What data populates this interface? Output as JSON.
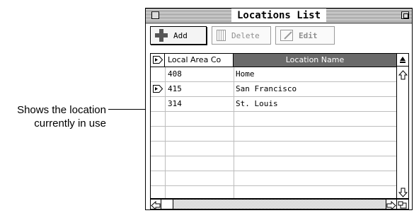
{
  "callout": {
    "line1": "Shows the location",
    "line2": "currently in use"
  },
  "window": {
    "title": "Locations List"
  },
  "toolbar": {
    "add_label": "Add",
    "delete_label": "Delete",
    "edit_label": "Edit",
    "delete_enabled": false,
    "edit_enabled": false
  },
  "table": {
    "columns": [
      "Local Area Co",
      "Location Name"
    ],
    "sorted_column": "Location Name",
    "rows": [
      {
        "code": "408",
        "name": "Home",
        "current": false
      },
      {
        "code": "415",
        "name": "San Francisco",
        "current": true
      },
      {
        "code": "314",
        "name": "St. Louis",
        "current": false
      },
      {
        "code": "",
        "name": "",
        "current": false
      },
      {
        "code": "",
        "name": "",
        "current": false
      },
      {
        "code": "",
        "name": "",
        "current": false
      },
      {
        "code": "",
        "name": "",
        "current": false
      },
      {
        "code": "",
        "name": "",
        "current": false
      },
      {
        "code": "",
        "name": "",
        "current": false
      }
    ]
  }
}
